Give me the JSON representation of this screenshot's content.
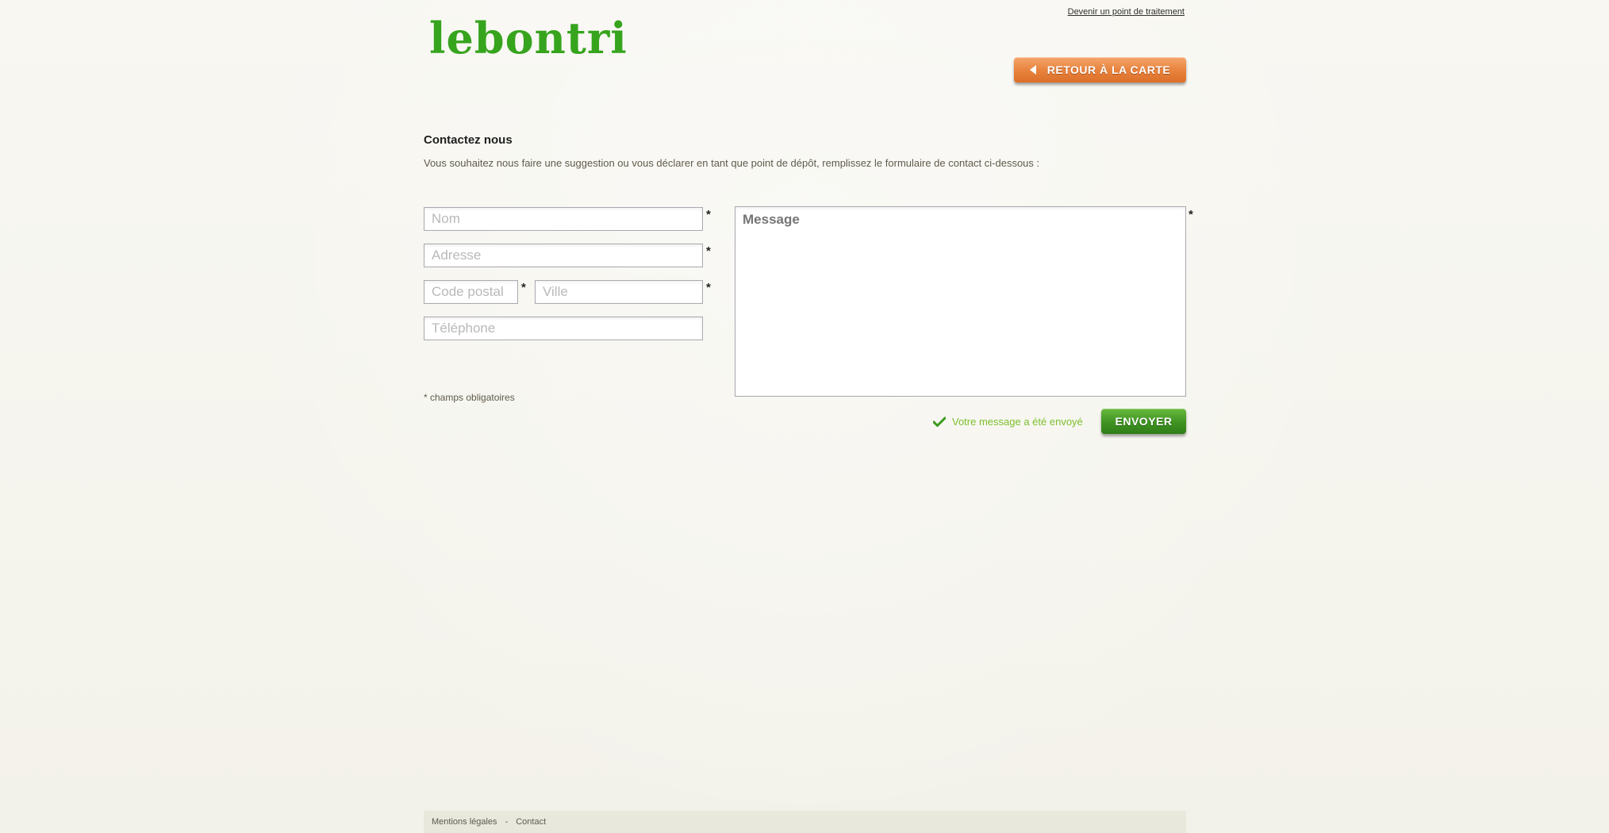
{
  "header": {
    "logo_text": "lebontri",
    "top_link": "Devenir un point de traitement",
    "back_button": "RETOUR À LA CARTE"
  },
  "intro": {
    "title": "Contactez nous",
    "text": "Vous souhaitez nous faire une suggestion ou vous déclarer en tant que point de dépôt, remplissez le formulaire de contact ci-dessous :"
  },
  "form": {
    "nom_placeholder": "Nom",
    "adresse_placeholder": "Adresse",
    "code_postal_placeholder": "Code postal",
    "ville_placeholder": "Ville",
    "telephone_placeholder": "Téléphone",
    "message_placeholder": "Message",
    "required_star": "*",
    "required_note": "* champs obligatoires",
    "status": "Votre message a été envoyé",
    "send_button": "ENVOYER"
  },
  "footer": {
    "mentions": "Mentions légales",
    "separator": "-",
    "contact": "Contact"
  },
  "colors": {
    "brand_green": "#36a41d",
    "orange_button": "#e9843f",
    "success_green": "#7cbf2c"
  },
  "icons": {
    "back": "triangle-left-icon",
    "status": "checkmark-icon"
  }
}
